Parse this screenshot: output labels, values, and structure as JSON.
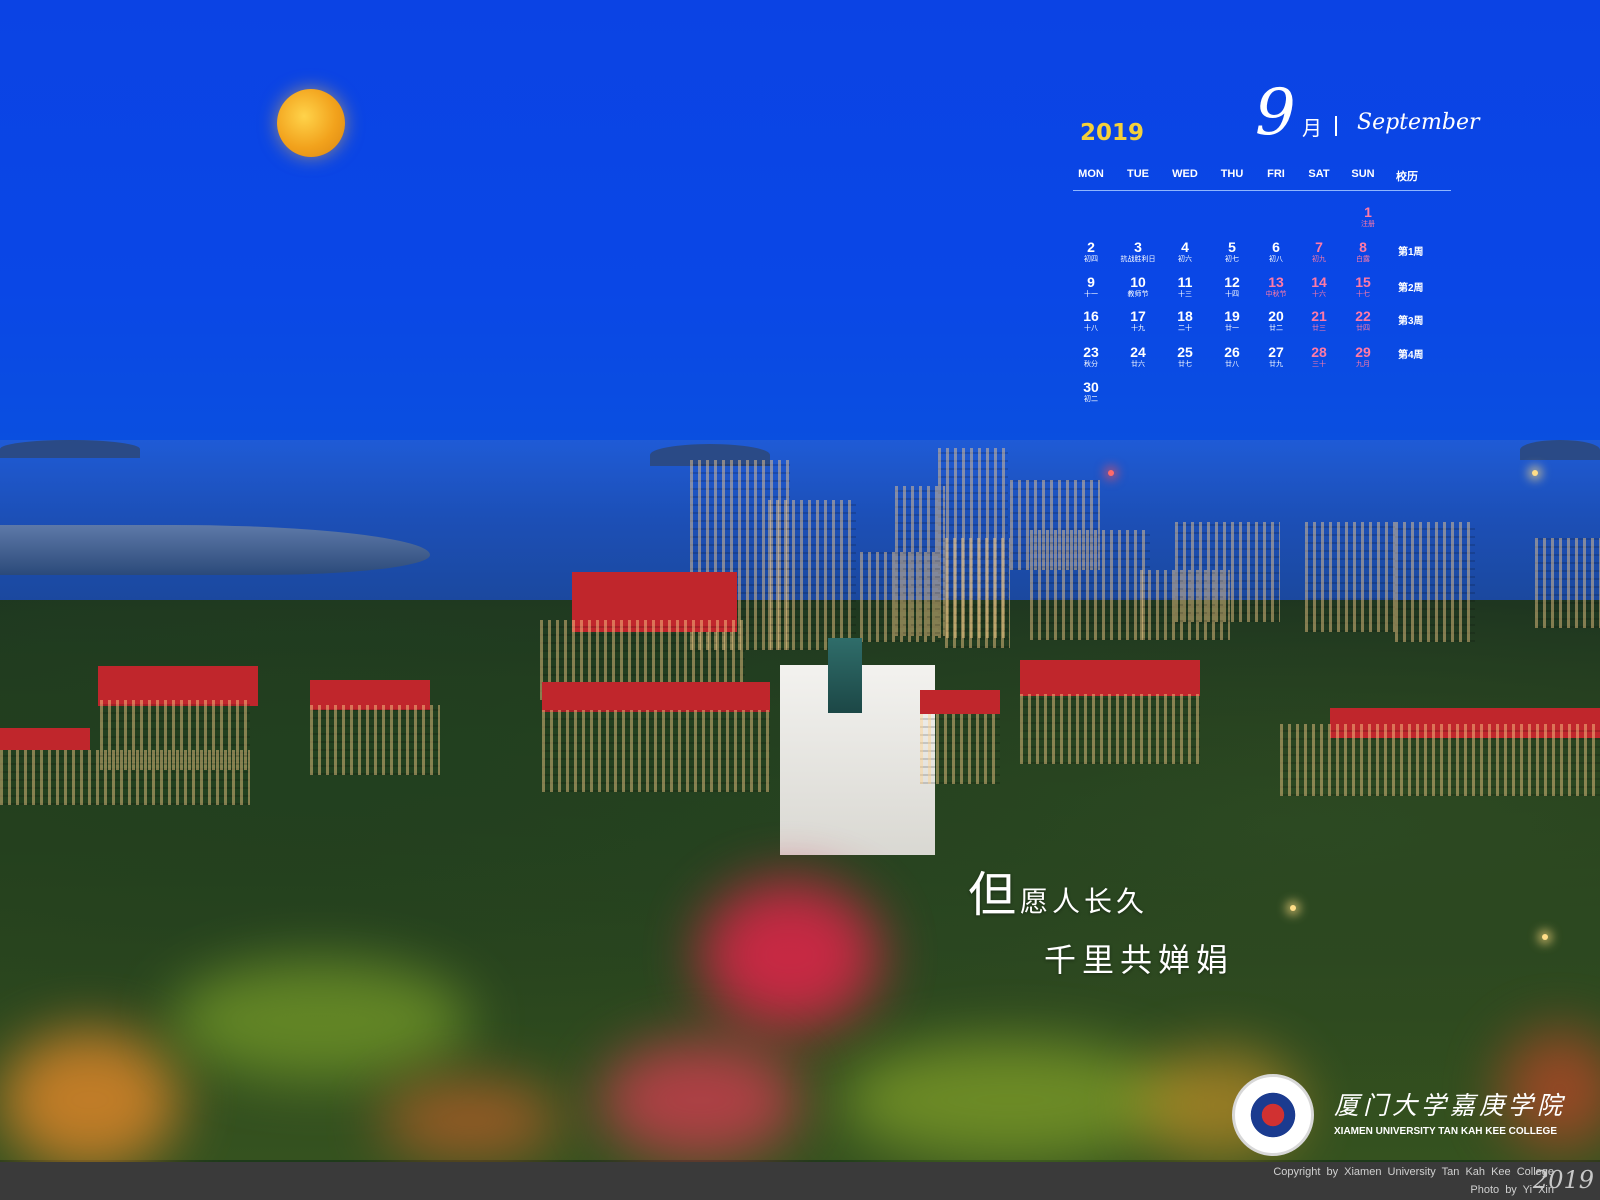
{
  "calendar": {
    "year": "2019",
    "month_num": "9",
    "month_cn": "月",
    "month_en": "September",
    "weekdays": [
      "MON",
      "TUE",
      "WED",
      "THU",
      "FRI",
      "SAT",
      "SUN",
      "校历"
    ],
    "days": [
      {
        "n": "1",
        "s": "注册"
      },
      {
        "n": "2",
        "s": "初四"
      },
      {
        "n": "3",
        "s": "抗战胜利日"
      },
      {
        "n": "4",
        "s": "初六"
      },
      {
        "n": "5",
        "s": "初七"
      },
      {
        "n": "6",
        "s": "初八"
      },
      {
        "n": "7",
        "s": "初九"
      },
      {
        "n": "8",
        "s": "白露"
      },
      {
        "n": "9",
        "s": "十一"
      },
      {
        "n": "10",
        "s": "教师节"
      },
      {
        "n": "11",
        "s": "十三"
      },
      {
        "n": "12",
        "s": "十四"
      },
      {
        "n": "13",
        "s": "中秋节"
      },
      {
        "n": "14",
        "s": "十六"
      },
      {
        "n": "15",
        "s": "十七"
      },
      {
        "n": "16",
        "s": "十八"
      },
      {
        "n": "17",
        "s": "十九"
      },
      {
        "n": "18",
        "s": "二十"
      },
      {
        "n": "19",
        "s": "廿一"
      },
      {
        "n": "20",
        "s": "廿二"
      },
      {
        "n": "21",
        "s": "廿三"
      },
      {
        "n": "22",
        "s": "廿四"
      },
      {
        "n": "23",
        "s": "秋分"
      },
      {
        "n": "24",
        "s": "廿六"
      },
      {
        "n": "25",
        "s": "廿七"
      },
      {
        "n": "26",
        "s": "廿八"
      },
      {
        "n": "27",
        "s": "廿九"
      },
      {
        "n": "28",
        "s": "三十"
      },
      {
        "n": "29",
        "s": "九月"
      },
      {
        "n": "30",
        "s": "初二"
      }
    ],
    "weeks": [
      "第1周",
      "第2周",
      "第3周",
      "第4周"
    ]
  },
  "poem": {
    "line1_big": "但",
    "line1_rest": "愿人长久",
    "line2": "千里共婵娟"
  },
  "logo": {
    "cn": "厦门大学嘉庚学院",
    "en": "XIAMEN UNIVERSITY TAN KAH KEE COLLEGE"
  },
  "footer": {
    "copyright": "Copyright by Xiamen University Tan Kah Kee College",
    "photo": "Photo by Yi Xin",
    "year": "2019"
  },
  "colors": {
    "sky": "#0b43e4",
    "year_accent": "#f4d03a",
    "weekend": "#ff7aa6"
  }
}
